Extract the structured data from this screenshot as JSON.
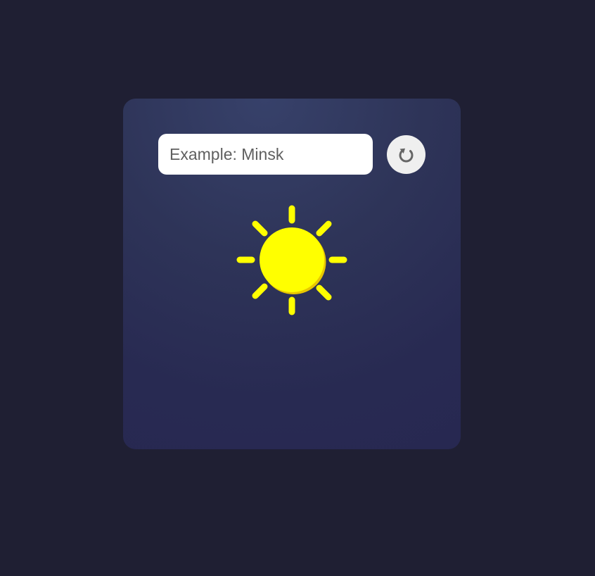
{
  "search": {
    "placeholder": "Example: Minsk",
    "value": ""
  },
  "refresh_button": {
    "icon": "refresh-icon"
  },
  "weather": {
    "icon": "sun-icon",
    "color": "#ffff00"
  },
  "colors": {
    "page_background": "#1f1f33",
    "card_top": "#37416a",
    "card_bottom": "#272851",
    "input_background": "#ffffff",
    "button_background": "#efefef",
    "icon_gray": "#666666"
  }
}
